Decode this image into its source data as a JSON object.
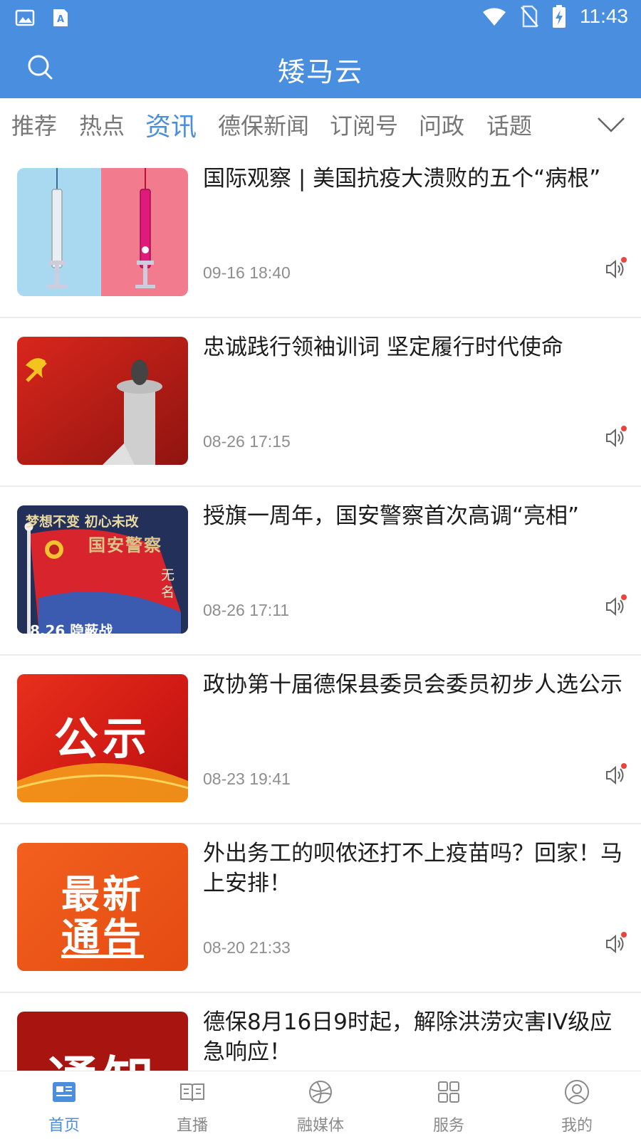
{
  "status_bar": {
    "time": "11:43"
  },
  "header": {
    "title": "矮马云"
  },
  "tabs": [
    {
      "label": "推荐",
      "active": false
    },
    {
      "label": "热点",
      "active": false
    },
    {
      "label": "资讯",
      "active": true
    },
    {
      "label": "德保新闻",
      "active": false
    },
    {
      "label": "订阅号",
      "active": false
    },
    {
      "label": "问政",
      "active": false
    },
    {
      "label": "话题",
      "active": false
    }
  ],
  "news": [
    {
      "title": "国际观察 | 美国抗疫大溃败的五个“病根”",
      "time": "09-16 18:40"
    },
    {
      "title": "忠诚践行领袖训词 坚定履行时代使命",
      "time": "08-26 17:15"
    },
    {
      "title": "授旗一周年，国安警察首次高调“亮相”",
      "time": "08-26 17:11",
      "thumb_text": {
        "line1": "梦想不变 初心未改",
        "line2": "国安警察",
        "side": "无名",
        "bottom": "8.26 隐蔽战"
      }
    },
    {
      "title": "政协第十届德保县委员会委员初步人选公示",
      "time": "08-23 19:41",
      "thumb_text": {
        "main": "公示"
      }
    },
    {
      "title": "外出务工的呗侬还打不上疫苗吗？回家！马上安排！",
      "time": "08-20 21:33",
      "thumb_text": {
        "line1": "最新",
        "line2": "通告"
      }
    },
    {
      "title": "德保8月16日9时起，解除洪涝灾害IV级应急响应！",
      "time": "",
      "thumb_text": {
        "main": "通知"
      }
    }
  ],
  "bottom_nav": [
    {
      "label": "首页",
      "icon": "news-icon",
      "active": true
    },
    {
      "label": "直播",
      "icon": "book-icon",
      "active": false
    },
    {
      "label": "融媒体",
      "icon": "globe-icon",
      "active": false
    },
    {
      "label": "服务",
      "icon": "grid-icon",
      "active": false
    },
    {
      "label": "我的",
      "icon": "user-icon",
      "active": false
    }
  ],
  "colors": {
    "accent": "#4a8ee0",
    "notify_dot": "#e8453c"
  }
}
